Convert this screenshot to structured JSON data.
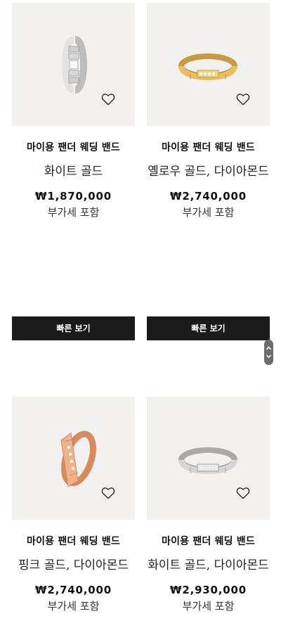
{
  "products": [
    {
      "name": "마이용 팬더 웨딩 밴드",
      "material": "화이트 골드",
      "price": "₩1,870,000",
      "vat": "부가세 포함",
      "ring_color": "white-gold"
    },
    {
      "name": "마이용 팬더 웨딩 밴드",
      "material": "옐로우 골드, 다이아몬드",
      "price": "₩2,740,000",
      "vat": "부가세 포함",
      "ring_color": "yellow-gold"
    },
    {
      "name": "마이용 팬더 웨딩 밴드",
      "material": "핑크 골드, 다이아몬드",
      "price": "₩2,740,000",
      "vat": "부가세 포함",
      "ring_color": "pink-gold"
    },
    {
      "name": "마이용 팬더 웨딩 밴드",
      "material": "화이트 골드, 다이아몬드",
      "price": "₩2,930,000",
      "vat": "부가세 포함",
      "ring_color": "white-gold"
    }
  ],
  "quick_view_label": "빠른 보기",
  "icons": {
    "wishlist": "heart-outline-icon",
    "scroll_up": "chevron-up-icon",
    "scroll_down": "chevron-down-icon"
  },
  "colors": {
    "image_background": "#f2f1ef",
    "button_background": "#1a1a1a",
    "white_gold": "#d4d4d4",
    "yellow_gold": "#e0b65a",
    "pink_gold": "#e6a67a"
  }
}
